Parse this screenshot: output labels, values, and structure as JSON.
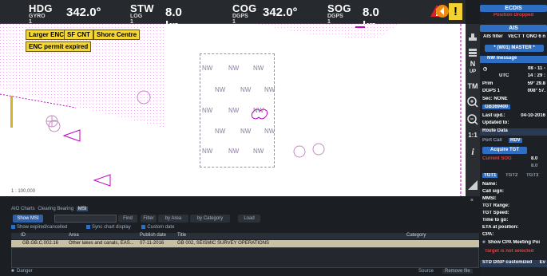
{
  "nav": {
    "hdg": {
      "label": "HDG",
      "sub": "GYRO 1",
      "value": "342.0°"
    },
    "stw": {
      "label": "STW",
      "sub": "LOG 1",
      "value": "8.0 kn"
    },
    "cog": {
      "label": "COG",
      "sub": "DGPS 1",
      "value": "342.0°"
    },
    "sog": {
      "label": "SOG",
      "sub": "DGPS 1",
      "value": "8.0 kn"
    },
    "alarm_icon": "warning-triangle-icon",
    "info_icon": "exclamation-icon",
    "info_glyph": "!"
  },
  "chart": {
    "buttons": [
      "Larger ENC",
      "SF CNT",
      "Shore Centre"
    ],
    "permit_label": "ENC permit expired",
    "scale": "1 : 100,000",
    "nw_label": "NW",
    "colors": {
      "magenta": "#c400c4",
      "permit": "#f4d735"
    }
  },
  "toolbar": {
    "north_up": "N",
    "north_up_sub": "UP",
    "tm": "TM",
    "zoom_in": "+",
    "zoom_out": "−",
    "ratio": "1:1",
    "info": "i"
  },
  "panel": {
    "ecdis_title": "ECDIS",
    "ecdis_status": "Position Dropped",
    "ais_title": "AIS",
    "ais_filter": "AIS filter",
    "ais_filter_val": "VECT T ONO",
    "ais_filter_num": "6 n",
    "master": "* (W01) MASTER *",
    "nw_message": "NW message",
    "date": "08 - 11 -",
    "utc_label": "UTC",
    "utc_time": "14 : 29 :",
    "prim_label": "Prim",
    "prim_val": "59° 29.8",
    "dgps_label": "DGPS 1",
    "dgps_val": "008° 57.",
    "sec_label": "Sec: NONE",
    "id_val": "GB369400",
    "last_upd_label": "Last upd.:",
    "last_upd_val": "04-10-2016",
    "updated_to": "Updated to:",
    "route_data": "Route Data",
    "port_call": "Port Call",
    "rdv": "RDV",
    "acquire_tgt": "Acquire TGT",
    "current_sog": "Current SOG",
    "current_sog_val": "8.0",
    "current_sog_val2": "8.0",
    "tgt_tabs": [
      "TGT1",
      "TGT2",
      "TGT3"
    ],
    "name": "Name:",
    "call_sign": "Call sign:",
    "mmsi": "MMSI:",
    "tgt_range": "TGT Range:",
    "tgt_speed": "TGT Speed:",
    "time_to_go": "Time to go:",
    "eta": "ETA at position:",
    "cpa": "CPA:",
    "show_cpa": "Show CPA Meeting Poi",
    "target_not_sel": "Target is not selected",
    "std_disp": "STD DISP customized",
    "ev": "Ev"
  },
  "bottom": {
    "tabs": [
      "AIO Charts",
      "Clearing Bearing",
      "MSI"
    ],
    "active_tab": "MSI",
    "show_msi": "Show MSI",
    "find": "Find",
    "filter": "Filter",
    "by_area": "by Area",
    "by_category": "by Category",
    "load": "Load",
    "show_expired": "Show expired/cancelled",
    "sync_chart": "Sync chart display",
    "custom_date": "Custom date",
    "columns": [
      "ID",
      "Area",
      "Publish date",
      "Title",
      "Category"
    ],
    "rows": [
      {
        "id": "GB.GB.C.002.16",
        "area": "Other lakes and canals, EAS...",
        "date": "07-11-2016",
        "title": "GB 002, SEISMIC SURVEY OPERATIONS",
        "category": ""
      }
    ],
    "danger": "Danger",
    "source": "Source",
    "remove": "Remove file"
  }
}
